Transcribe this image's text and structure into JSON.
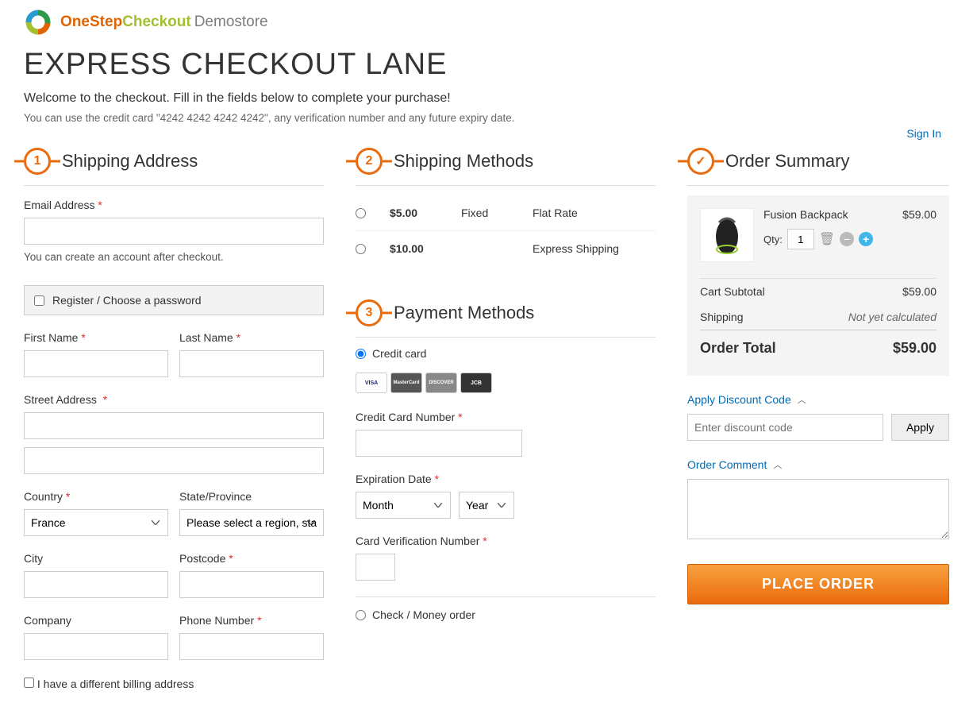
{
  "header": {
    "logo_part1": "OneStep",
    "logo_part2": "Checkout",
    "logo_part3": "Demostore",
    "signin": "Sign In"
  },
  "page": {
    "title": "EXPRESS CHECKOUT LANE",
    "welcome": "Welcome to the checkout. Fill in the fields below to complete your purchase!",
    "hint": "You can use the credit card \"4242 4242 4242 4242\", any verification number and any future expiry date."
  },
  "steps": {
    "shipping_address": {
      "num": "1",
      "title": "Shipping Address"
    },
    "shipping_methods": {
      "num": "2",
      "title": "Shipping Methods"
    },
    "payment_methods": {
      "num": "3",
      "title": "Payment Methods"
    },
    "order_summary": {
      "num": "✓",
      "title": "Order Summary"
    }
  },
  "shipping_address": {
    "email_label": "Email Address",
    "email_sub": "You can create an account after checkout.",
    "register_label": "Register / Choose a password",
    "first_name": "First Name",
    "last_name": "Last Name",
    "street": "Street Address",
    "country": "Country",
    "state": "State/Province",
    "city": "City",
    "postcode": "Postcode",
    "company": "Company",
    "phone": "Phone Number",
    "country_value": "France",
    "state_placeholder": "Please select a region, state or province",
    "billing_check": "I have a different billing address"
  },
  "shipping_methods": {
    "rows": [
      {
        "price": "$5.00",
        "type": "Fixed",
        "name": "Flat Rate"
      },
      {
        "price": "$10.00",
        "type": "",
        "name": "Express Shipping"
      }
    ]
  },
  "payment": {
    "credit_card": "Credit card",
    "cc_number": "Credit Card Number",
    "exp_date": "Expiration Date",
    "month": "Month",
    "year": "Year",
    "cvv": "Card Verification Number",
    "check_money": "Check / Money order"
  },
  "order": {
    "item_name": "Fusion Backpack",
    "qty_label": "Qty:",
    "qty_value": "1",
    "item_price": "$59.00",
    "subtotal_label": "Cart Subtotal",
    "subtotal_value": "$59.00",
    "shipping_label": "Shipping",
    "shipping_value": "Not yet calculated",
    "total_label": "Order Total",
    "total_value": "$59.00",
    "discount_head": "Apply Discount Code",
    "discount_placeholder": "Enter discount code",
    "apply": "Apply",
    "comment_head": "Order Comment",
    "place_order": "PLACE ORDER"
  }
}
